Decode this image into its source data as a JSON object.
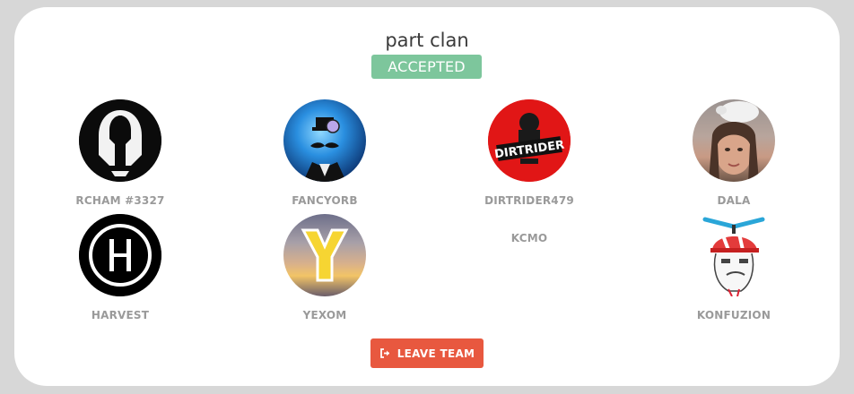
{
  "team": {
    "name": "part clan",
    "status": "ACCEPTED",
    "status_color": "#7dc69c"
  },
  "members": [
    {
      "name": "RCHAM #3327",
      "avatar_icon": "spartan-helmet-icon"
    },
    {
      "name": "FANCYORB",
      "avatar_icon": "monocle-orb-icon"
    },
    {
      "name": "DIRTRIDER479",
      "avatar_icon": "dirtrider-logo-icon"
    },
    {
      "name": "DALA",
      "avatar_icon": "photo-avatar"
    },
    {
      "name": "HARVEST",
      "avatar_icon": "letter-h-icon"
    },
    {
      "name": "YEXOM",
      "avatar_icon": "letter-y-icon"
    },
    {
      "name": "KCMO",
      "avatar_icon": ""
    },
    {
      "name": "KONFUZION",
      "avatar_icon": "propeller-hat-meme-icon"
    }
  ],
  "actions": {
    "leave_label": "LEAVE TEAM",
    "leave_color": "#e8583f",
    "leave_icon": "sign-out-icon"
  }
}
